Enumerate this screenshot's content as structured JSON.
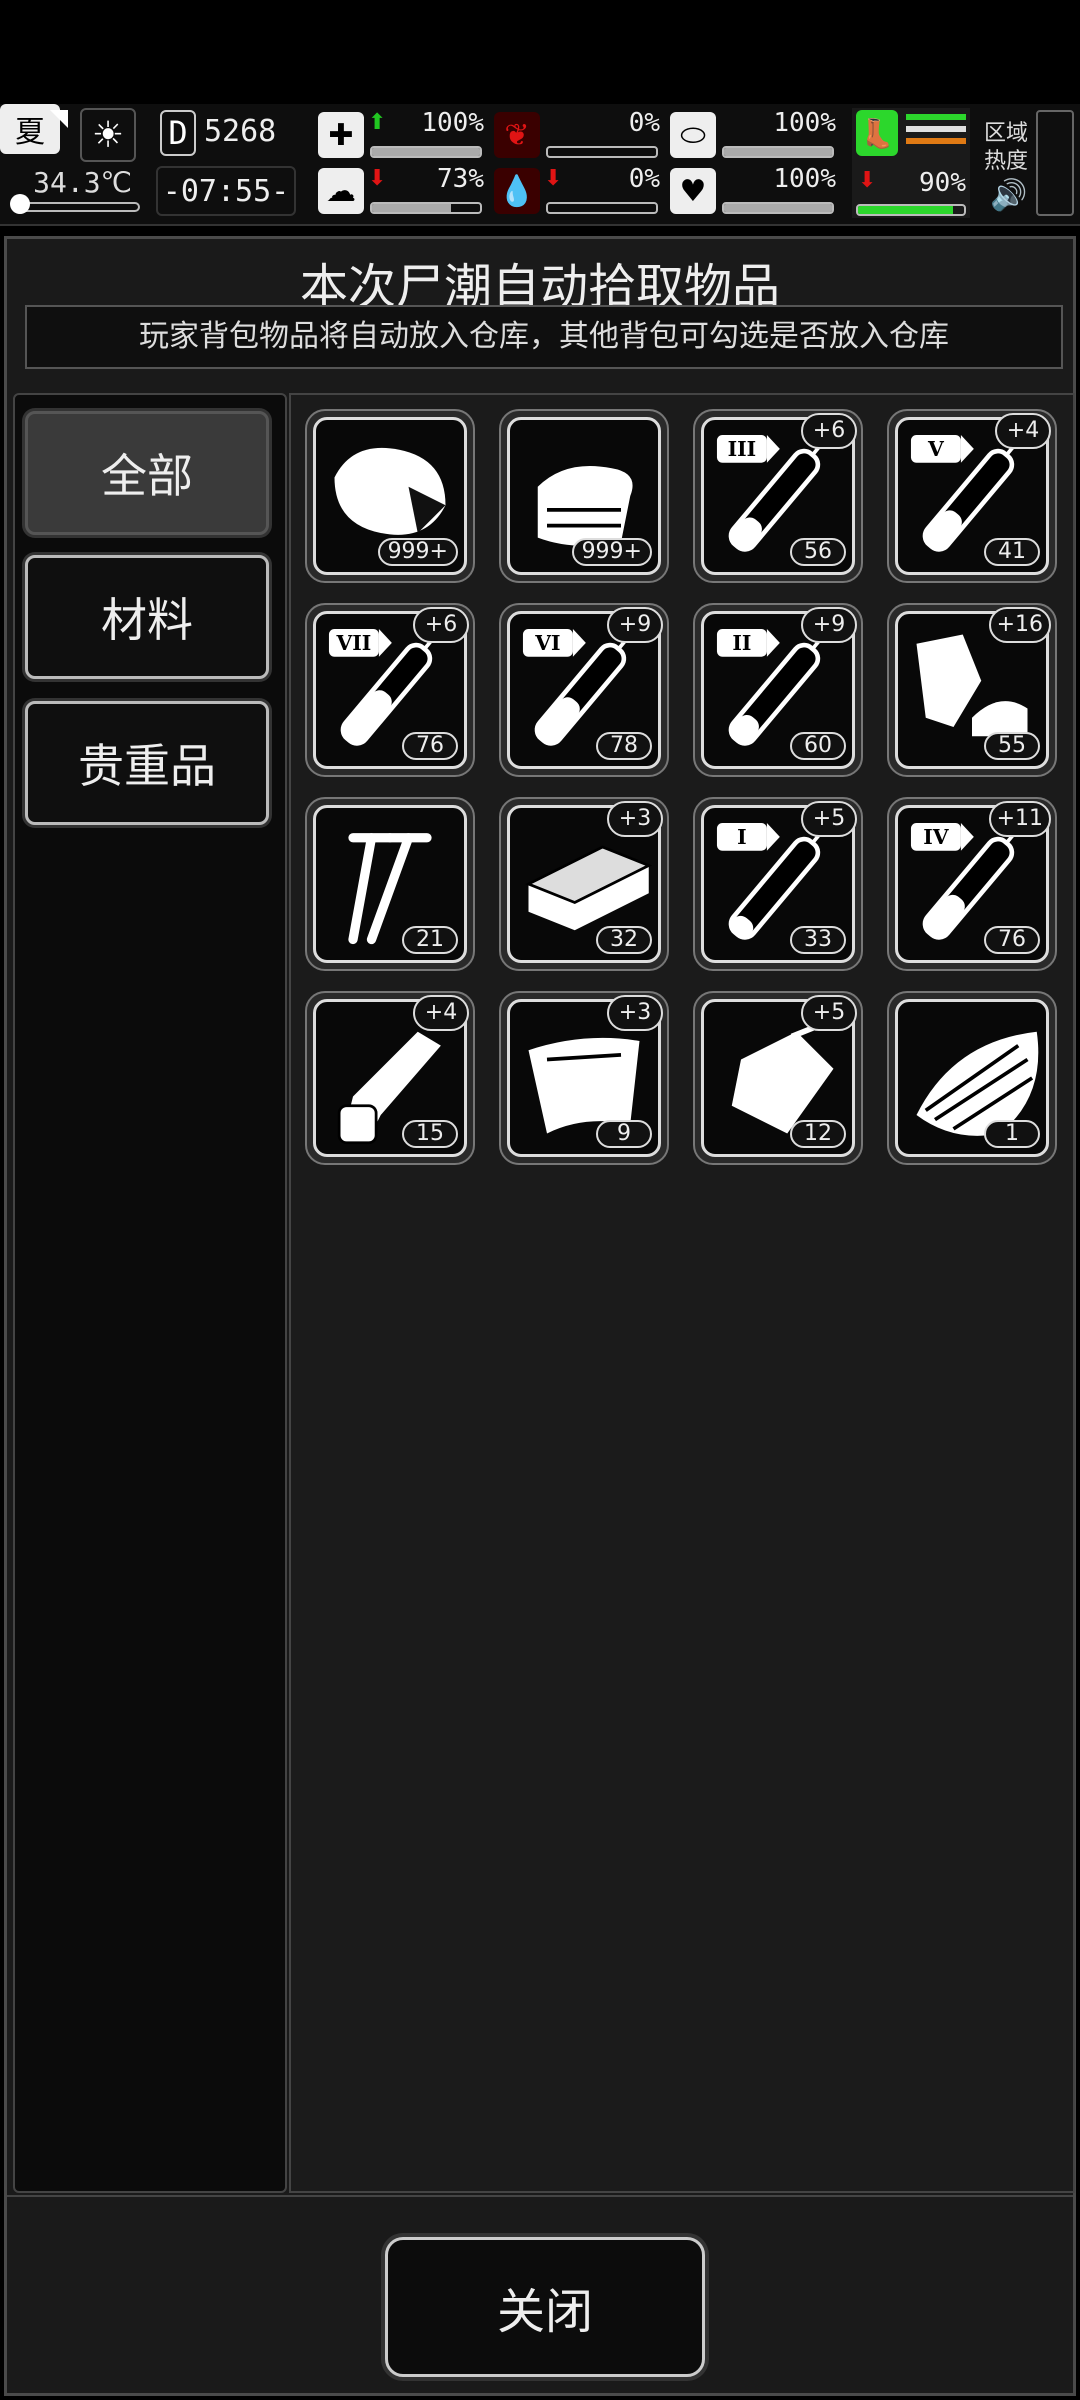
{
  "hud": {
    "season": "夏",
    "temperature": "34.3℃",
    "day_prefix": "D",
    "day": "5268",
    "clock": "-07:55-",
    "health": {
      "value": "100%",
      "trend": "up",
      "fill": 1.0
    },
    "hunger": {
      "value": "0%",
      "trend": "none",
      "fill": 0.0
    },
    "stamina": {
      "value": "100%",
      "fill": 1.0
    },
    "mind": {
      "value": "73%",
      "trend": "down",
      "fill": 0.73
    },
    "thirst": {
      "value": "0%",
      "trend": "down",
      "fill": 0.0
    },
    "heart": {
      "value": "100%",
      "fill": 1.0
    },
    "legs": {
      "value": "90%",
      "trend": "down",
      "fill": 0.9
    },
    "zone_label": "区域热度",
    "colors": {
      "up": "#21c621",
      "down": "#e01414",
      "legs": "#2cd72c",
      "lines": [
        "#2cd72c",
        "#e0e0e0",
        "#e07a14"
      ]
    }
  },
  "panel": {
    "title": "本次尸潮自动拾取物品",
    "note": "玩家背包物品将自动放入仓库，其他背包可勾选是否放入仓库"
  },
  "categories": [
    {
      "label": "全部",
      "active": true
    },
    {
      "label": "材料",
      "active": false
    },
    {
      "label": "贵重品",
      "active": false
    }
  ],
  "items": [
    {
      "icon": "meat-icon",
      "count": "999+",
      "bonus": ""
    },
    {
      "icon": "cloth-icon",
      "count": "999+",
      "bonus": ""
    },
    {
      "icon": "syringe-iii-icon",
      "roman": "III",
      "count": "56",
      "bonus": "+6",
      "level": 0.35
    },
    {
      "icon": "syringe-v-icon",
      "roman": "V",
      "count": "41",
      "bonus": "+4",
      "level": 0.45
    },
    {
      "icon": "syringe-vii-icon",
      "roman": "VII",
      "count": "76",
      "bonus": "+6",
      "level": 0.65
    },
    {
      "icon": "syringe-vi-icon",
      "roman": "VI",
      "count": "78",
      "bonus": "+9",
      "level": 0.55
    },
    {
      "icon": "syringe-ii-icon",
      "roman": "II",
      "count": "60",
      "bonus": "+9",
      "level": 0.3
    },
    {
      "icon": "rags-icon",
      "count": "55",
      "bonus": "+16"
    },
    {
      "icon": "nails-icon",
      "count": "21",
      "bonus": ""
    },
    {
      "icon": "board-icon",
      "count": "32",
      "bonus": "+3"
    },
    {
      "icon": "syringe-i-icon",
      "roman": "I",
      "count": "33",
      "bonus": "+5",
      "level": 0.2
    },
    {
      "icon": "syringe-iv-icon",
      "roman": "IV",
      "count": "76",
      "bonus": "+11",
      "level": 0.5
    },
    {
      "icon": "bandage-roll-icon",
      "count": "15",
      "bonus": "+4"
    },
    {
      "icon": "paper-icon",
      "count": "9",
      "bonus": "+3"
    },
    {
      "icon": "bag-icon",
      "count": "12",
      "bonus": "+5"
    },
    {
      "icon": "wood-scraps-icon",
      "count": "1",
      "bonus": ""
    }
  ],
  "close_label": "关闭"
}
